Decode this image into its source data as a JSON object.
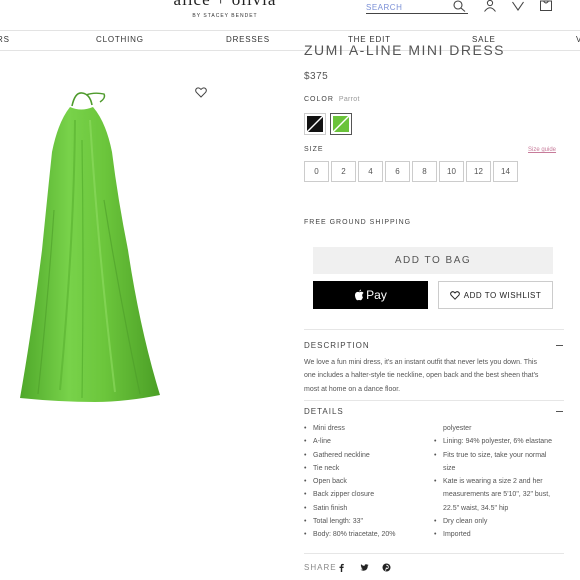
{
  "header": {
    "logo_main": "alice + olivia",
    "logo_sub": "BY STACEY BENDET",
    "search_placeholder": "SEARCH"
  },
  "nav": {
    "items": [
      "RS",
      "CLOTHING",
      "DRESSES",
      "THE EDIT",
      "SALE",
      "V"
    ]
  },
  "product": {
    "title": "ZUMI A-LINE MINI DRESS",
    "price": "$375",
    "color_label": "COLOR",
    "color_value": "Parrot",
    "swatches": [
      {
        "name": "black",
        "color": "#111111"
      },
      {
        "name": "parrot",
        "color": "#6ac33a"
      }
    ],
    "size_label": "SIZE",
    "size_guide": "Size guide",
    "sizes": [
      "0",
      "2",
      "4",
      "6",
      "8",
      "10",
      "12",
      "14"
    ],
    "shipping": "FREE GROUND SHIPPING",
    "add_to_bag": "ADD TO BAG",
    "apple_pay": "Pay",
    "add_to_wishlist": "ADD TO WISHLIST"
  },
  "description": {
    "heading": "DESCRIPTION",
    "lines": [
      "We love a fun mini dress, it's an instant outfit that never lets you down. This",
      "one includes a halter-style tie neckline, open back and the best sheen that's",
      "most at home on a dance floor."
    ]
  },
  "details": {
    "heading": "DETAILS",
    "left": [
      "Mini dress",
      "A-line",
      "Gathered neckline",
      "Tie neck",
      "Open back",
      "Back zipper closure",
      "Satin finish",
      "Total length: 33\"",
      "Body: 80% triacetate, 20%"
    ],
    "right_cont": "polyester",
    "right": [
      {
        "text": "Lining: 94% polyester, 6% elastane"
      },
      {
        "text": "Fits true to size, take your normal"
      },
      {
        "text": "size",
        "cont": true
      },
      {
        "text": "Kate is wearing a size 2 and her"
      },
      {
        "text": "measurements are 5'10\", 32\" bust,",
        "cont": true
      },
      {
        "text": "22.5\" waist, 34.5\" hip",
        "cont": true
      },
      {
        "text": "Dry clean only"
      },
      {
        "text": "Imported"
      }
    ]
  },
  "share": {
    "label": "SHARE",
    "icons": [
      "facebook-icon",
      "twitter-icon",
      "pinterest-icon"
    ]
  },
  "colors": {
    "dress_green": "#6ac33a",
    "size_guide_pink": "#c77b9a",
    "search_blue": "#7a8fd6"
  }
}
